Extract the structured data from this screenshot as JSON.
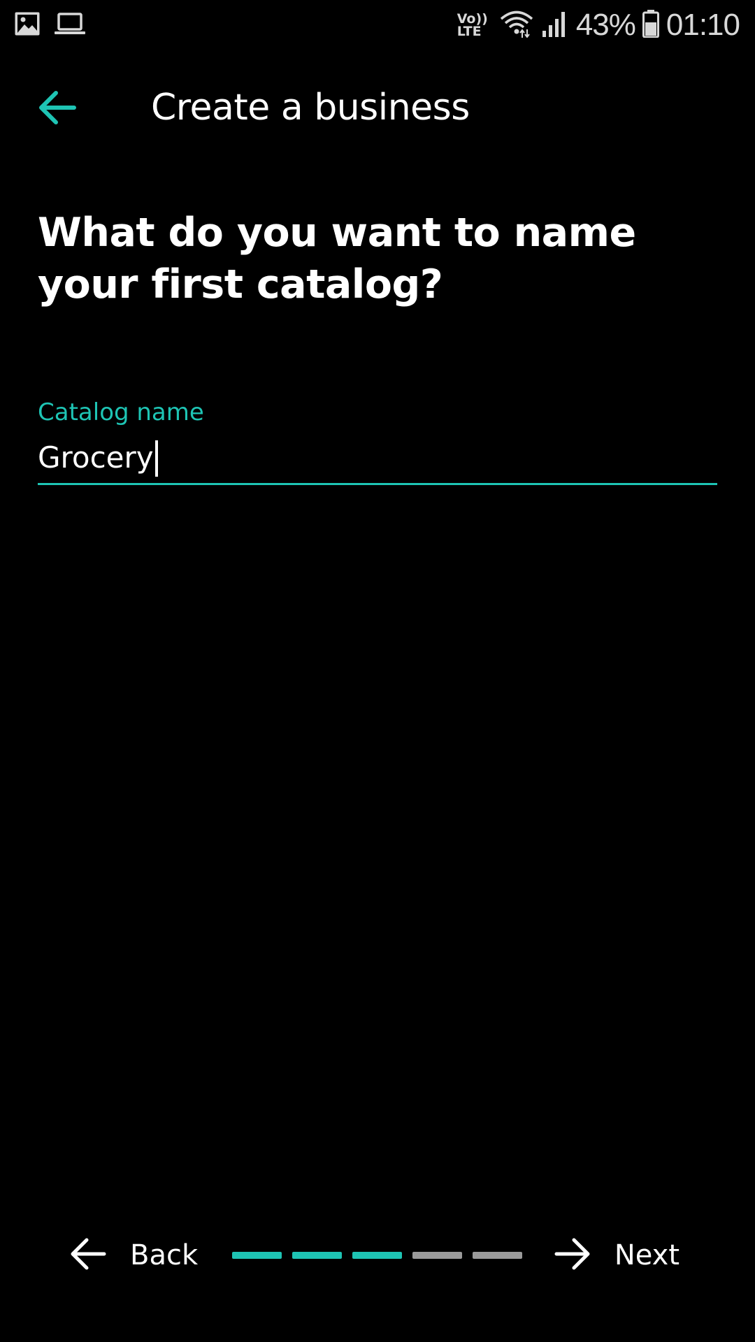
{
  "status_bar": {
    "left_icons": [
      "image-icon",
      "laptop-icon"
    ],
    "network_label_top": "Vo))",
    "network_label_bottom": "LTE",
    "battery_percent": "43%",
    "time": "01:10"
  },
  "app_bar": {
    "title": "Create a business",
    "back_icon": "arrow-left-icon"
  },
  "question": {
    "text": "What do you want to name your first catalog?"
  },
  "catalog_field": {
    "label": "Catalog name",
    "value": "Grocery"
  },
  "bottom_nav": {
    "back_label": "Back",
    "next_label": "Next",
    "progress": {
      "total_steps": 5,
      "completed_steps": 3
    }
  },
  "colors": {
    "accent": "#1ec4b4",
    "background": "#000000",
    "inactive_step": "#9a9a9a",
    "text": "#ffffff"
  }
}
